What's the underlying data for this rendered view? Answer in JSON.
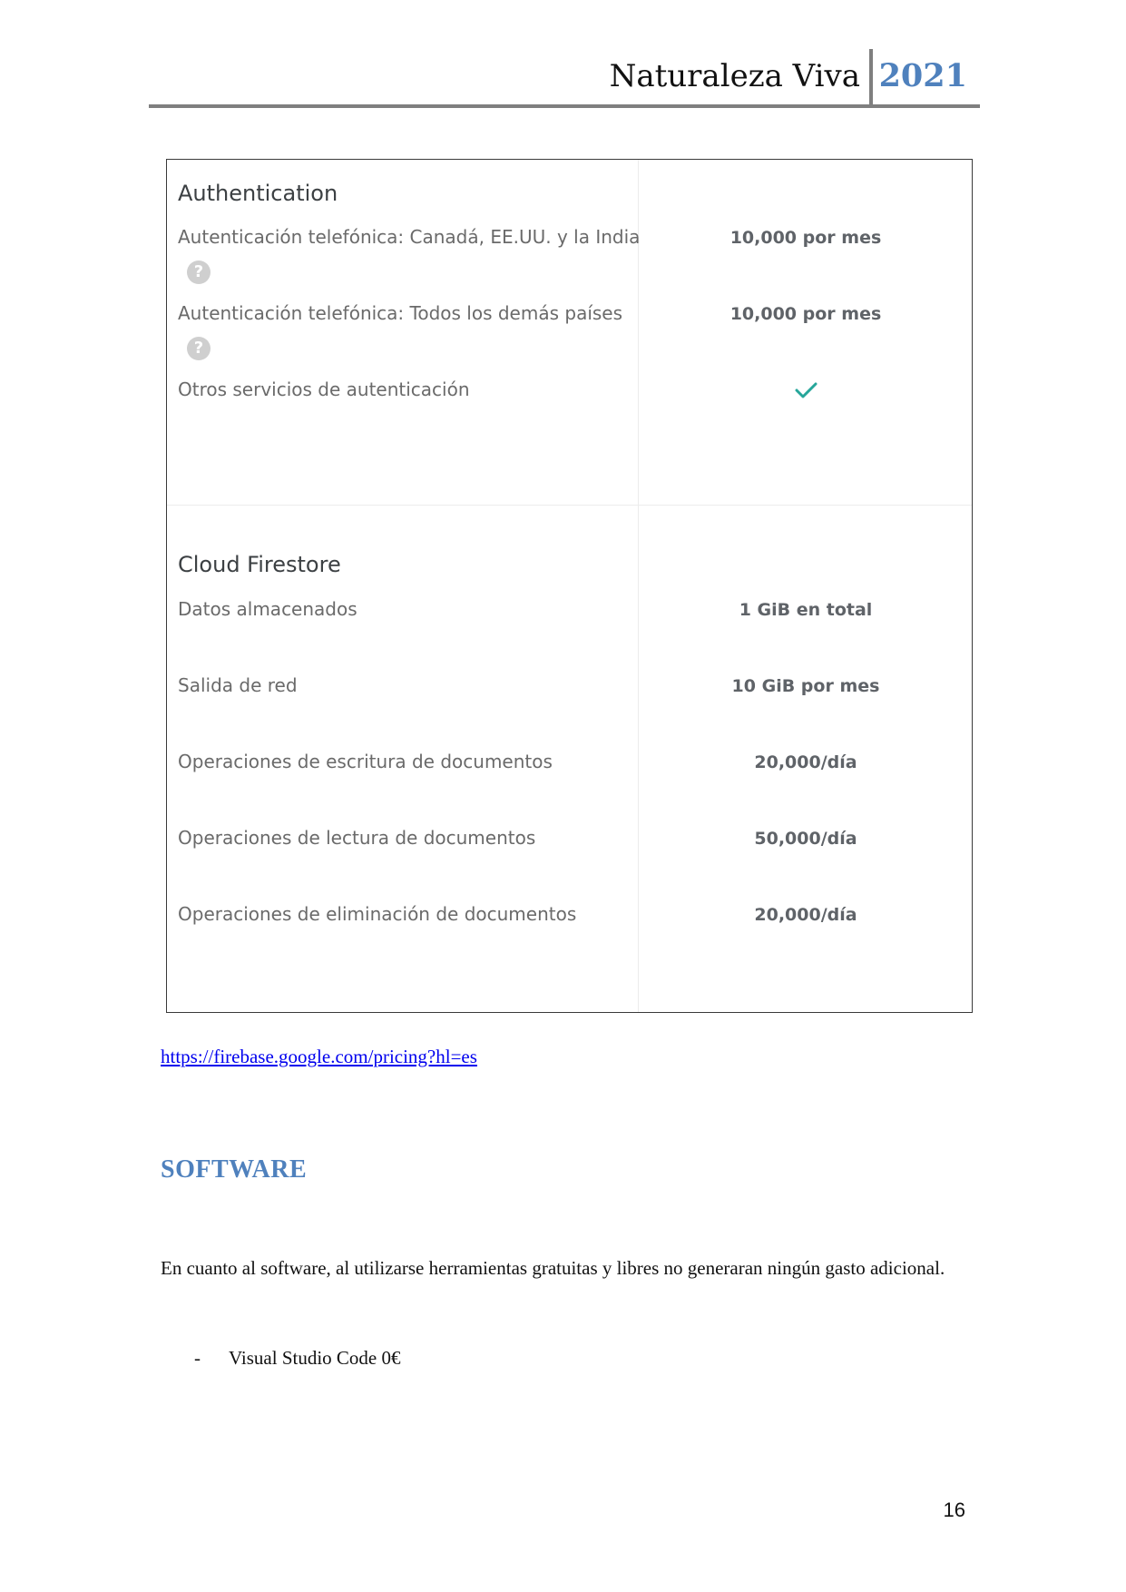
{
  "header": {
    "title": "Naturaleza Viva",
    "year": "2021"
  },
  "pricing": {
    "sections": [
      {
        "title": "Authentication",
        "rows": [
          {
            "label": "Autenticación telefónica: Canadá, EE.UU. y la India",
            "value": "10,000 por mes",
            "help": "?"
          },
          {
            "label": "Autenticación telefónica: Todos los demás países",
            "value": "10,000 por mes",
            "help": "?"
          },
          {
            "label": "Otros servicios de autenticación",
            "value_icon": "check-icon"
          }
        ]
      },
      {
        "title": "Cloud Firestore",
        "rows": [
          {
            "label": "Datos almacenados",
            "value": "1 GiB en total"
          },
          {
            "label": "Salida de red",
            "value": "10 GiB por mes"
          },
          {
            "label": "Operaciones de escritura de documentos",
            "value": "20,000/día"
          },
          {
            "label": "Operaciones de lectura de documentos",
            "value": "50,000/día"
          },
          {
            "label": "Operaciones de eliminación de documentos",
            "value": "20,000/día"
          }
        ]
      }
    ],
    "check_color": "#26a69a"
  },
  "source_link": "https://firebase.google.com/pricing?hl=es",
  "software": {
    "heading": "SOFTWARE",
    "paragraph": "En cuanto al software, al utilizarse herramientas gratuitas y libres no generaran ningún gasto adicional.",
    "bullet_marker": "-",
    "items": [
      "Visual Studio Code 0€"
    ]
  },
  "page_number": "16",
  "colors": {
    "heading_blue": "#4f81bd",
    "rule_gray": "#7f7f7f",
    "link_blue": "#0000ee"
  }
}
